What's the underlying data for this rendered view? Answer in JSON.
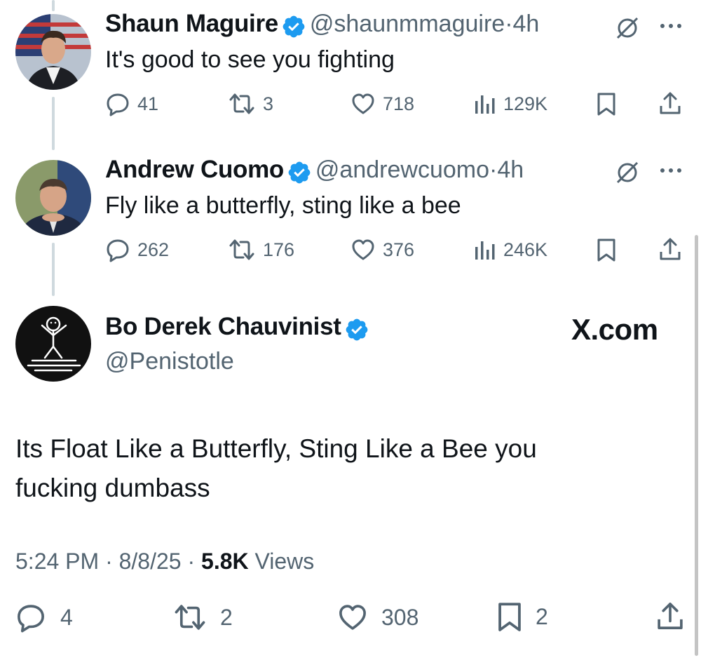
{
  "tweets": [
    {
      "name": "Shaun Maguire",
      "handle": "@shaunmmaguire",
      "time": "4h",
      "text": "It's good to see you fighting",
      "replies": "41",
      "retweets": "3",
      "likes": "718",
      "views": "129K"
    },
    {
      "name": "Andrew Cuomo",
      "handle": "@andrewcuomo",
      "time": "4h",
      "text": "Fly like a butterfly, sting like a bee",
      "replies": "262",
      "retweets": "176",
      "likes": "376",
      "views": "246K"
    }
  ],
  "main": {
    "name": "Bo Derek Chauvinist",
    "handle": "@Penistotle",
    "watermark": "X.com",
    "text_line1": "Its Float Like a Butterfly, Sting Like a Bee you",
    "text_line2": "fucking dumbass",
    "time": "5:24 PM",
    "date": "8/8/25",
    "views_count": "5.8K",
    "views_label": "Views",
    "replies": "4",
    "retweets": "2",
    "likes": "308",
    "bookmarks": "2"
  },
  "separator": "·",
  "colors": {
    "verified": "#1d9bf0",
    "muted": "#536471",
    "text": "#0f1419",
    "thread": "#cfd9de"
  },
  "icons": [
    "verified-icon",
    "grok-icon",
    "more-icon",
    "reply-icon",
    "retweet-icon",
    "like-icon",
    "views-icon",
    "bookmark-icon",
    "share-icon"
  ]
}
